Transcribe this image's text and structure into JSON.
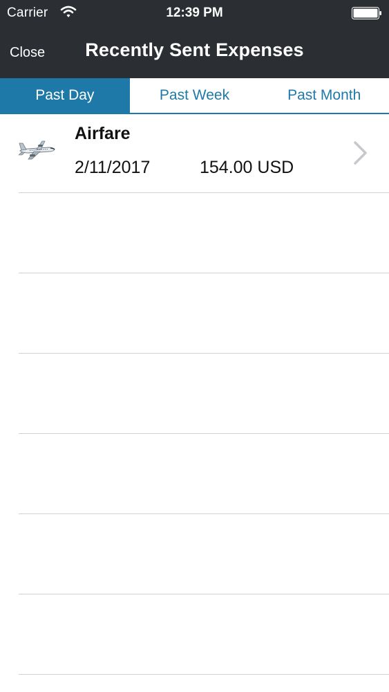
{
  "status_bar": {
    "carrier": "Carrier",
    "time": "12:39 PM"
  },
  "nav": {
    "close_label": "Close",
    "title": "Recently Sent Expenses"
  },
  "segments": {
    "items": [
      "Past Day",
      "Past Week",
      "Past Month"
    ],
    "selected": "Past Day"
  },
  "expenses": [
    {
      "icon": "airplane-icon",
      "type": "Airfare",
      "date": "2/11/2017",
      "amount": "154.00 USD"
    }
  ],
  "colors": {
    "topbar": "#2b2f33",
    "accent": "#1f79a8",
    "separator": "#cfd3d6",
    "chevron": "#c7c7cc"
  }
}
